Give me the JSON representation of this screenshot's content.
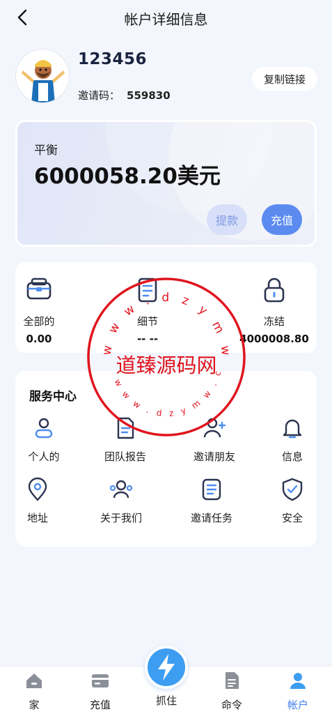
{
  "header": {
    "title": "帐户详细信息"
  },
  "profile": {
    "username": "123456",
    "invite_label": "邀请码：",
    "invite_code": "559830",
    "copy_button": "复制链接"
  },
  "balance": {
    "label": "平衡",
    "value": "6000058.20美元",
    "withdraw_label": "提款",
    "deposit_label": "充值"
  },
  "stats": [
    {
      "label": "全部的",
      "value": "0.00",
      "icon": "wallet-icon"
    },
    {
      "label": "细节",
      "value": "-- --",
      "icon": "document-icon"
    },
    {
      "label": "冻结",
      "value": "4000008.80",
      "icon": "lock-icon"
    }
  ],
  "services": {
    "title": "服务中心",
    "items": [
      {
        "label": "个人的",
        "icon": "user-icon"
      },
      {
        "label": "团队报告",
        "icon": "report-icon"
      },
      {
        "label": "邀请朋友",
        "icon": "add-user-icon"
      },
      {
        "label": "信息",
        "icon": "bell-icon"
      },
      {
        "label": "地址",
        "icon": "location-icon"
      },
      {
        "label": "关于我们",
        "icon": "team-icon"
      },
      {
        "label": "邀请任务",
        "icon": "task-icon"
      },
      {
        "label": "安全",
        "icon": "shield-icon"
      }
    ]
  },
  "watermark": {
    "text": "道臻源码网",
    "arc_text": "w w w . d z y m w . c o m"
  },
  "tabs": [
    {
      "label": "家",
      "icon": "home-icon"
    },
    {
      "label": "充值",
      "icon": "card-icon"
    },
    {
      "label": "抓住",
      "icon": "lightning-icon"
    },
    {
      "label": "命令",
      "icon": "order-icon"
    },
    {
      "label": "帐户",
      "icon": "account-icon"
    }
  ],
  "colors": {
    "accent": "#3d7df2",
    "deposit_button": "#5c8bf0",
    "withdraw_button": "#d7e0f8",
    "watermark": "#e0141e",
    "icon_dark": "#2b3450",
    "icon_blue": "#4d8cf0"
  }
}
